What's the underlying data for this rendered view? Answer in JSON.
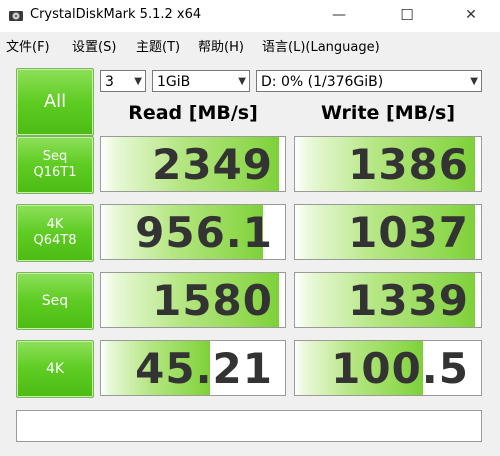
{
  "window": {
    "title": "CrystalDiskMark 5.1.2 x64",
    "minimize": "—",
    "maximize": "☐",
    "close": "✕"
  },
  "menu": [
    "文件(F)",
    "设置(S)",
    "主题(T)",
    "帮助(H)",
    "语言(L)(Language)"
  ],
  "controls": {
    "all_label": "All",
    "count": "3",
    "size": "1GiB",
    "drive": "D: 0% (1/376GiB)"
  },
  "headers": {
    "read": "Read [MB/s]",
    "write": "Write [MB/s]"
  },
  "rows": [
    {
      "line1": "Seq",
      "line2": "Q16T1",
      "read": "2349",
      "write": "1386",
      "read_fill": 0.97,
      "write_fill": 0.97
    },
    {
      "line1": "4K",
      "line2": "Q64T8",
      "read": "956.1",
      "write": "1037",
      "read_fill": 0.88,
      "write_fill": 0.97
    },
    {
      "line1": "Seq",
      "line2": "",
      "read": "1580",
      "write": "1339",
      "read_fill": 0.97,
      "write_fill": 0.97
    },
    {
      "line1": "4K",
      "line2": "",
      "read": "45.21",
      "write": "100.5",
      "read_fill": 0.59,
      "write_fill": 0.69
    }
  ],
  "status_text": "",
  "colors": {
    "accent_green": "#5ecc22",
    "value_text": "#333333"
  }
}
